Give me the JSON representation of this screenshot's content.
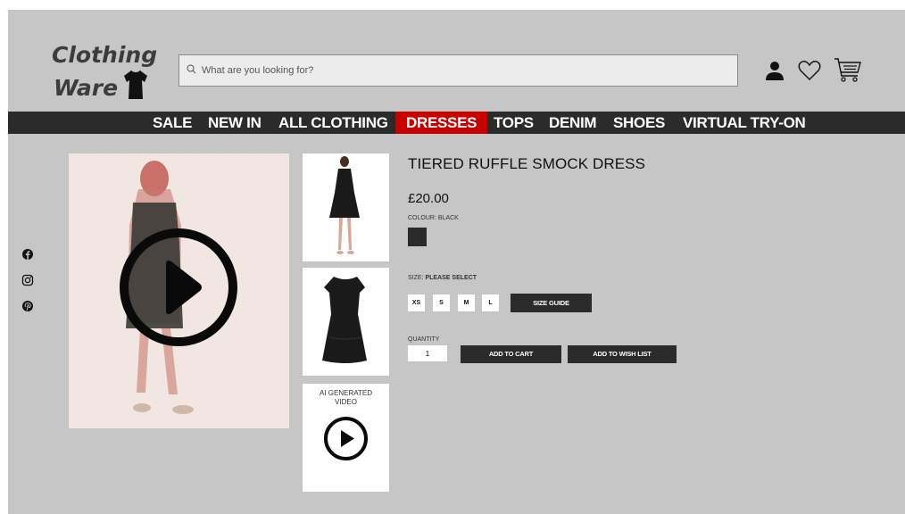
{
  "brand": {
    "line1": "Clothing",
    "line2": "Ware",
    "icon": "tshirt-icon"
  },
  "search": {
    "placeholder": "What are you looking for?",
    "value": "",
    "icon": "search-icon"
  },
  "header_icons": [
    "user-icon",
    "heart-icon",
    "cart-icon"
  ],
  "nav": {
    "items": [
      "SALE",
      "NEW IN",
      "ALL CLOTHING",
      "DRESSES",
      "TOPS",
      "DENIM",
      "SHOES",
      "VIRTUAL TRY-ON"
    ],
    "active": "DRESSES"
  },
  "social_icons": [
    "facebook-icon",
    "instagram-icon",
    "pinterest-icon"
  ],
  "gallery": {
    "main": "video-play-icon",
    "video_thumb_label": "AI GENERATED VIDEO"
  },
  "product": {
    "title": "TIERED RUFFLE SMOCK DRESS",
    "price": "£20.00",
    "colour_label": "COLOUR: BLACK",
    "colour_swatch": "#2b2b2b",
    "size_label_prefix": "SIZE:",
    "size_label_value": "PLEASE SELECT",
    "sizes": [
      "XS",
      "S",
      "M",
      "L"
    ],
    "size_guide": "SIZE GUIDE",
    "quantity_label": "QUANTITY",
    "quantity_value": "1",
    "add_to_cart": "ADD TO CART",
    "add_to_wishlist": "ADD TO WISH LIST"
  },
  "colors": {
    "page_bg": "#c6c6c6",
    "navbar": "#2b2b2b",
    "accent": "#c80000"
  }
}
